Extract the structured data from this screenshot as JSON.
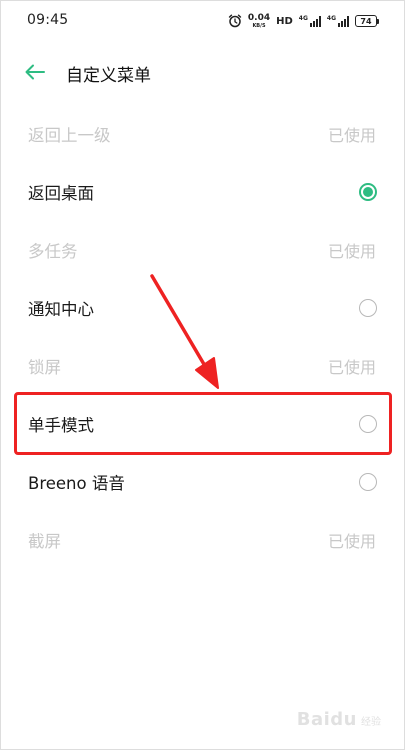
{
  "status_bar": {
    "time": "09:45",
    "net_speed_value": "0.04",
    "net_speed_unit": "KB/S",
    "hd_label": "HD",
    "signal1_label": "4G",
    "signal2_label": "4G",
    "battery_level": "74"
  },
  "header": {
    "title": "自定义菜单"
  },
  "menu": {
    "items": [
      {
        "label": "返回上一级",
        "status": "已使用",
        "state": "used"
      },
      {
        "label": "返回桌面",
        "state": "selected"
      },
      {
        "label": "多任务",
        "status": "已使用",
        "state": "used"
      },
      {
        "label": "通知中心",
        "state": "unselected"
      },
      {
        "label": "锁屏",
        "status": "已使用",
        "state": "used"
      },
      {
        "label": "单手模式",
        "state": "unselected"
      },
      {
        "label": "Breeno 语音",
        "state": "unselected"
      },
      {
        "label": "截屏",
        "status": "已使用",
        "state": "used"
      }
    ]
  },
  "colors": {
    "accent": "#2ebc82",
    "annotation": "#ee2222",
    "disabled_text": "#c8c8c8"
  },
  "watermark": {
    "logo": "Baidu",
    "sub": "经验"
  }
}
